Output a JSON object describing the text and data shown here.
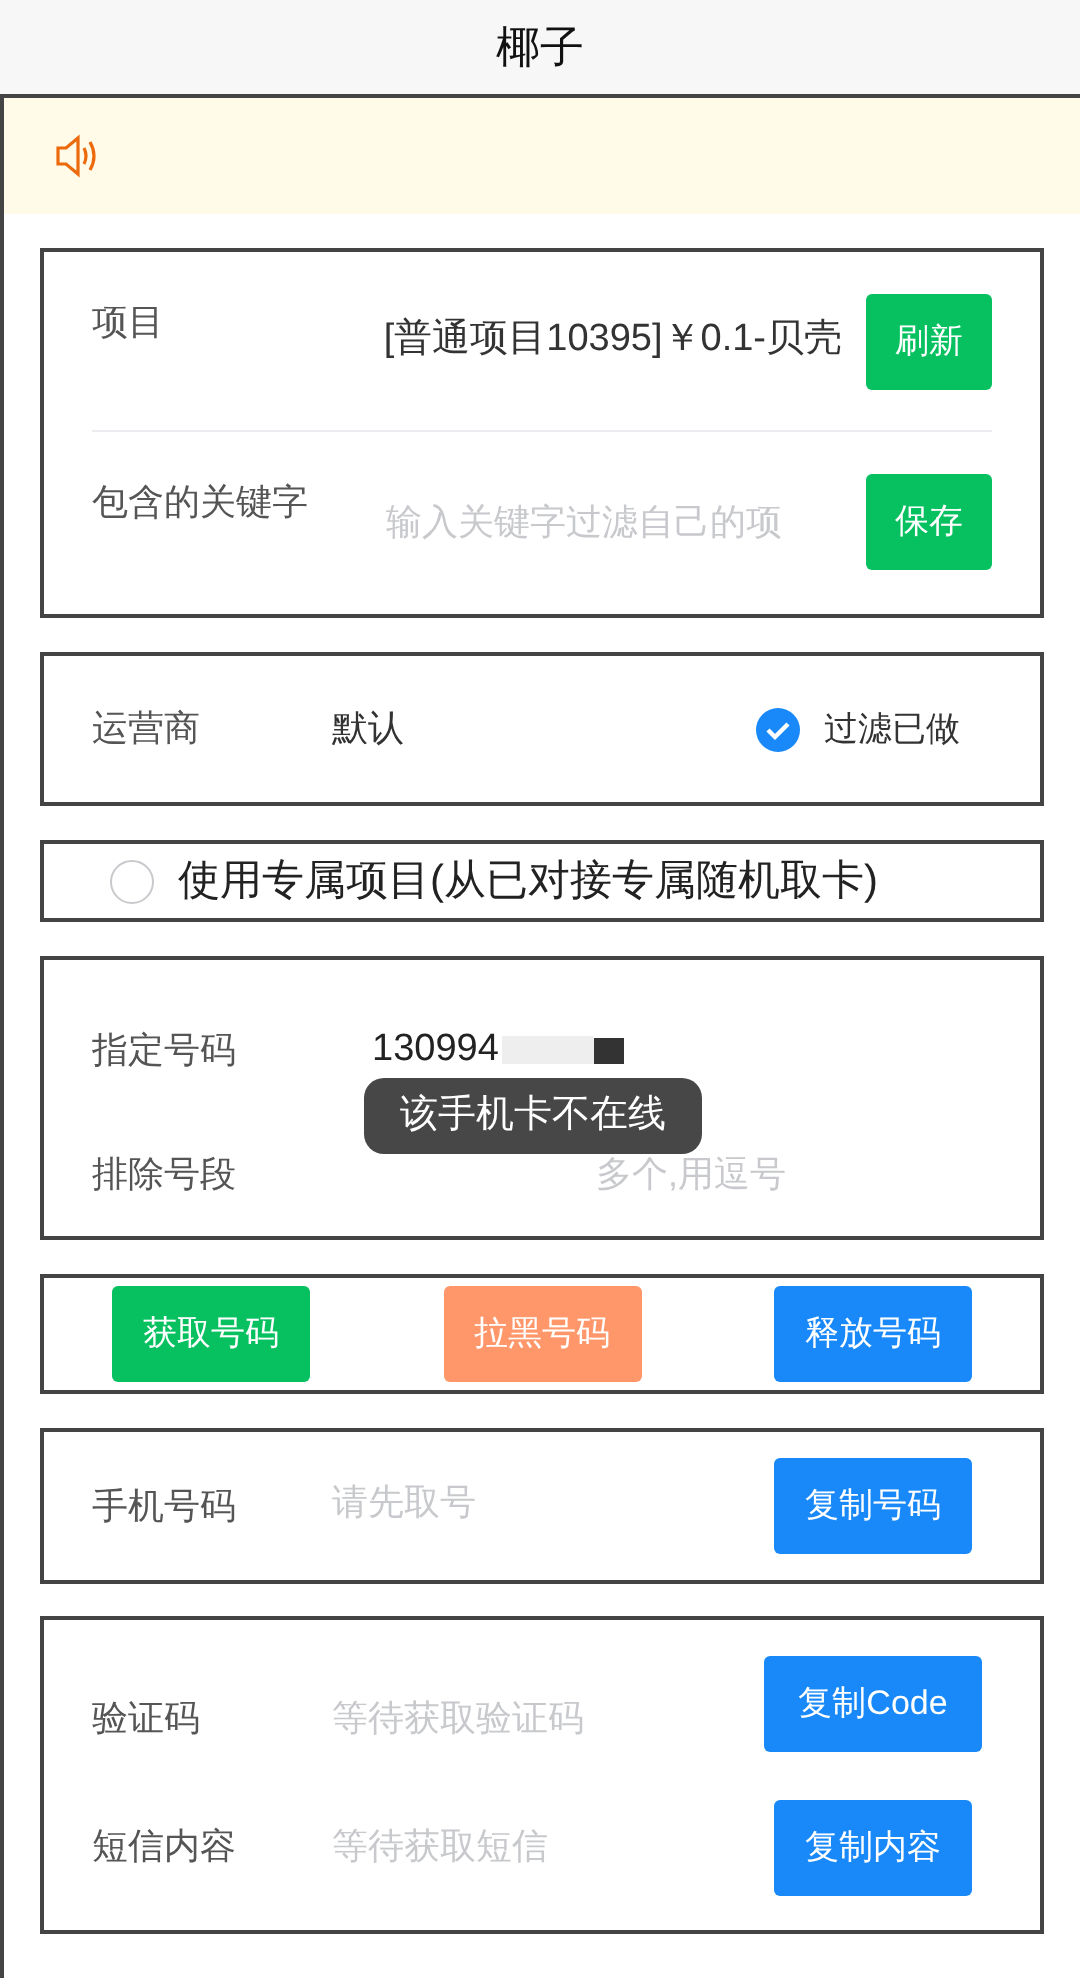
{
  "window": {
    "title": "椰子"
  },
  "project_card": {
    "rows": [
      {
        "label": "项目",
        "value": "[普通项目10395]￥0.1-贝壳",
        "button": {
          "label": "刷新",
          "kind": "success"
        }
      },
      {
        "label": "包含的关键字",
        "placeholder": "输入关键字过滤自己的项",
        "button": {
          "label": "保存",
          "kind": "success"
        }
      }
    ]
  },
  "carrier_card": {
    "label": "运营商",
    "value": "默认",
    "filter": {
      "label": "过滤已做",
      "checked": true
    }
  },
  "exclusive": {
    "label": "使用专属项目(从已对接专属随机取卡)",
    "checked": false
  },
  "number_card": {
    "rows": [
      {
        "label": "指定号码",
        "value": "130994"
      },
      {
        "label": "排除号段",
        "placeholder": "多个,用逗号"
      }
    ]
  },
  "toast": "该手机卡不在线",
  "actions": [
    {
      "label": "获取号码",
      "kind": "success"
    },
    {
      "label": "拉黑号码",
      "kind": "warning"
    },
    {
      "label": "释放号码",
      "kind": "primary"
    }
  ],
  "phone_card": {
    "label": "手机号码",
    "placeholder": "请先取号",
    "button": {
      "label": "复制号码",
      "kind": "primary"
    }
  },
  "code_card": {
    "rows": [
      {
        "label": "验证码",
        "placeholder": "等待获取验证码",
        "button": {
          "label": "复制Code",
          "kind": "primary"
        }
      },
      {
        "label": "短信内容",
        "placeholder": "等待获取短信",
        "button": {
          "label": "复制内容",
          "kind": "primary"
        }
      }
    ]
  }
}
